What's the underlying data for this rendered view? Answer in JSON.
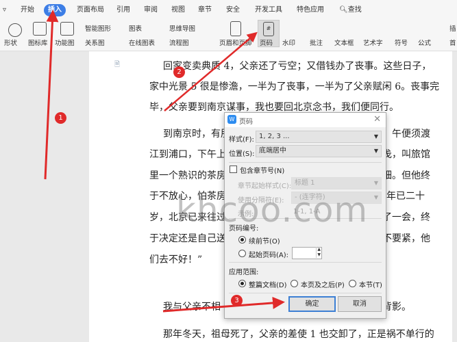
{
  "menu_tabs": [
    "开始",
    "插入",
    "页面布局",
    "引用",
    "审阅",
    "视图",
    "章节",
    "安全",
    "开发工具",
    "特色应用",
    "查找"
  ],
  "active_tab": "插入",
  "ribbon": {
    "shape": "形状",
    "icon_lib": "图标库",
    "func_chart": "功能图",
    "smart_art": "智能图形",
    "relation": "关系图",
    "chart": "图表",
    "online_chart": "在线图表",
    "mindmap": "思维导图",
    "flowchart": "流程图",
    "header_footer": "页眉和页脚",
    "page_number": "页码",
    "watermark": "水印",
    "comment": "批注",
    "textbox": "文本框",
    "wordart": "艺术字",
    "symbol": "符号",
    "formula": "公式",
    "insert_more": "插",
    "first_drop": "首"
  },
  "document": {
    "lines_full": [
      "回家变卖典质 4，父亲还了亏空；又借钱办了丧事。这些日子，",
      "家中光景 5 很是惨澹，一半为了丧事，一半为了父亲赋闲 6。丧事完",
      "毕，父亲要到南京谋事，我也要回北京念书，我们便同行。"
    ],
    "lines_left": [
      "到南京时，有朋",
      "江到浦口，下午上",
      "里一个熟识的茶房",
      "于不放心，怕茶房",
      "岁，北京已来往过",
      "于决定还是自己送",
      "们去不好！”"
    ],
    "lines_right": [
      "午便须渡",
      "戋，叫旅馆",
      "细。但他终",
      "年已二十",
      "了一会，终",
      "不要紧，他",
      ""
    ],
    "line_11_left": "我与父亲不相",
    "line_11_right": "背影。",
    "line_12": "那年冬天，祖母死了，父亲的差使 1 也交卸了，正是祸不单行的"
  },
  "dialog": {
    "title": "页码",
    "style_label": "样式(F):",
    "style_value": "1, 2, 3 ...",
    "position_label": "位置(S):",
    "position_value": "底端居中",
    "include_chapter": "包含章节号(N)",
    "include_chapter_checked": false,
    "chapter_style_label": "章节起始样式(C):",
    "chapter_style_value": "标题 1",
    "separator_label": "使用分隔符(E):",
    "separator_value": "-   (连字符)",
    "example_label": "示例:",
    "example_value": "1-1, 1-A",
    "numbering_label": "页码编号:",
    "continue": "续前节(O)",
    "start_at": "起始页码(A):",
    "start_at_value": "",
    "numbering_selected": "continue",
    "apply_label": "应用范围:",
    "apply_options": [
      "整篇文档(D)",
      "本页及之后(P)",
      "本节(T)"
    ],
    "apply_selected": "整篇文档(D)",
    "ok": "确定",
    "cancel": "取消"
  },
  "annotations": {
    "step1": "1",
    "step2": "2",
    "step3": "3",
    "color": "#e02a2a"
  },
  "watermark_text": "khcoo.com",
  "colors": {
    "accent": "#3d7ee6"
  }
}
